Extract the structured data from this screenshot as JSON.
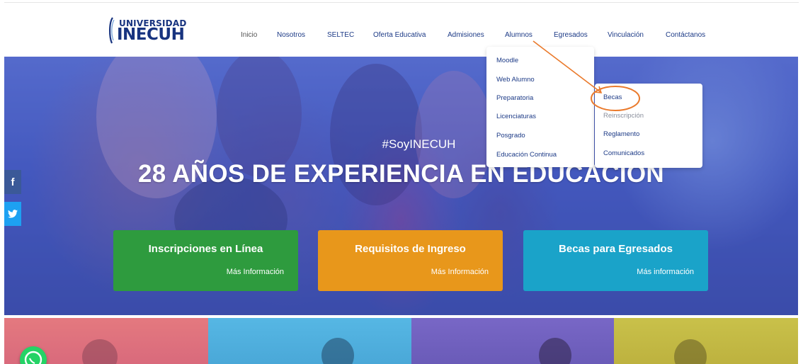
{
  "logo": {
    "top_text": "UNIVERSIDAD",
    "main_text": "INECUH"
  },
  "nav": {
    "items": [
      {
        "label": "Inicio"
      },
      {
        "label": "Nosotros"
      },
      {
        "label": "SELTEC"
      },
      {
        "label": "Oferta Educativa"
      },
      {
        "label": "Admisiones"
      },
      {
        "label": "Alumnos"
      },
      {
        "label": "Egresados"
      },
      {
        "label": "Vinculación"
      },
      {
        "label": "Contáctanos"
      }
    ]
  },
  "alumnos_menu": {
    "items": [
      {
        "label": "Moodle"
      },
      {
        "label": "Web Alumno"
      },
      {
        "label": "Preparatoria"
      },
      {
        "label": "Licenciaturas"
      },
      {
        "label": "Posgrado"
      },
      {
        "label": "Educación Continua"
      }
    ]
  },
  "licenciaturas_submenu": {
    "items": [
      {
        "label": "Becas"
      },
      {
        "label": "Reinscripción"
      },
      {
        "label": "Reglamento"
      },
      {
        "label": "Comunicados"
      }
    ]
  },
  "hero": {
    "tag": "#SoyINECUH",
    "title": "28 AÑOS DE EXPERIENCIA EN EDUCACIÓN"
  },
  "cta_cards": [
    {
      "title": "Inscripciones en Línea",
      "link": "Más Información",
      "color": "#2e9b3e"
    },
    {
      "title": "Requisitos de Ingreso",
      "link": "Más Información",
      "color": "#e8971b"
    },
    {
      "title": "Becas para Egresados",
      "link": "Más información",
      "color": "#1aa3c9"
    }
  ],
  "social": [
    {
      "icon": "facebook-icon",
      "glyph": "f",
      "color": "#3b5998"
    },
    {
      "icon": "twitter-icon",
      "glyph": "🐦",
      "color": "#1da1f2"
    }
  ],
  "annotation": {
    "color": "#ea7a2c"
  },
  "colors": {
    "brand": "#1c3a86",
    "whatsapp": "#25d366"
  },
  "bottom_tiles": [
    {
      "color": "#e4797f"
    },
    {
      "color": "#56b7e4"
    },
    {
      "color": "#7867c6"
    },
    {
      "color": "#c9c14a"
    }
  ]
}
